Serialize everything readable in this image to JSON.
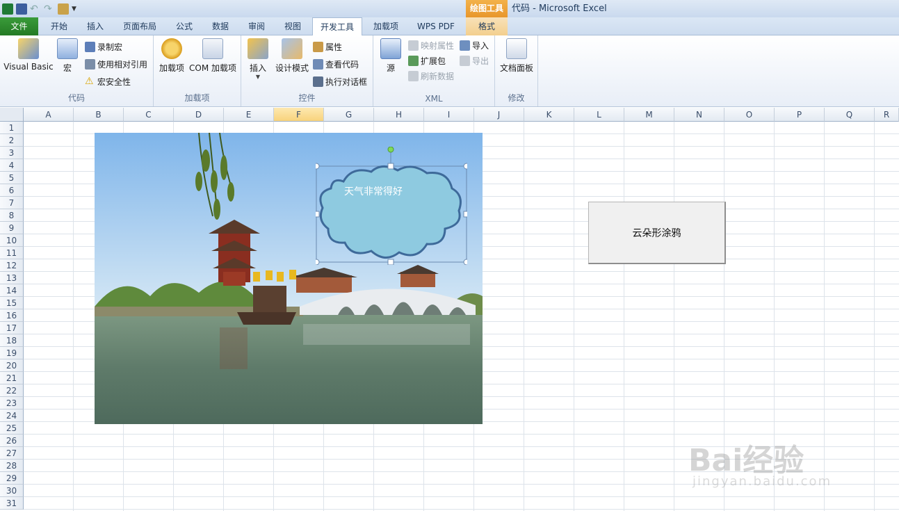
{
  "titlebar": {
    "context_tab": "绘图工具",
    "document_title": "代码 - Microsoft Excel"
  },
  "tabs": [
    {
      "label": "文件"
    },
    {
      "label": "开始"
    },
    {
      "label": "插入"
    },
    {
      "label": "页面布局"
    },
    {
      "label": "公式"
    },
    {
      "label": "数据"
    },
    {
      "label": "审阅"
    },
    {
      "label": "视图"
    },
    {
      "label": "开发工具",
      "active": true
    },
    {
      "label": "加载项"
    },
    {
      "label": "WPS PDF"
    },
    {
      "label": "格式"
    }
  ],
  "ribbon": {
    "code": {
      "label": "代码",
      "visual_basic": "Visual Basic",
      "macros": "宏",
      "record_macro": "录制宏",
      "relative_ref": "使用相对引用",
      "macro_security": "宏安全性"
    },
    "addins": {
      "label": "加载项",
      "addins_btn": "加载项",
      "com_addins": "COM 加载项"
    },
    "controls": {
      "label": "控件",
      "insert": "插入",
      "design_mode": "设计模式",
      "properties": "属性",
      "view_code": "查看代码",
      "run_dialog": "执行对话框"
    },
    "xml": {
      "label": "XML",
      "source": "源",
      "map_props": "映射属性",
      "expansion_packs": "扩展包",
      "refresh_data": "刷新数据",
      "import": "导入",
      "export": "导出"
    },
    "modify": {
      "label": "修改",
      "document_panel": "文档面板"
    }
  },
  "sheet": {
    "columns": [
      "A",
      "B",
      "C",
      "D",
      "E",
      "F",
      "G",
      "H",
      "I",
      "J",
      "K",
      "L",
      "M",
      "N",
      "O",
      "P",
      "Q",
      "R"
    ],
    "selected_column": "F",
    "rows": [
      "1",
      "2",
      "3",
      "4",
      "5",
      "6",
      "7",
      "8",
      "9",
      "10",
      "11",
      "12",
      "13",
      "14",
      "15",
      "16",
      "17",
      "18",
      "19",
      "20",
      "21",
      "22",
      "23",
      "24",
      "25",
      "26",
      "27",
      "28",
      "29",
      "30",
      "31"
    ]
  },
  "shape": {
    "cloud_text": "天气非常得好"
  },
  "macro_button": {
    "label": "云朵形涂鸦"
  },
  "watermark": {
    "brand": "Bai经验",
    "url": "jingyan.baidu.com"
  },
  "colors": {
    "file_tab": "#2d8a2d",
    "cloud_fill": "#8ecae0",
    "cloud_stroke": "#3e6a9a",
    "selected_header": "#f8d37c"
  }
}
